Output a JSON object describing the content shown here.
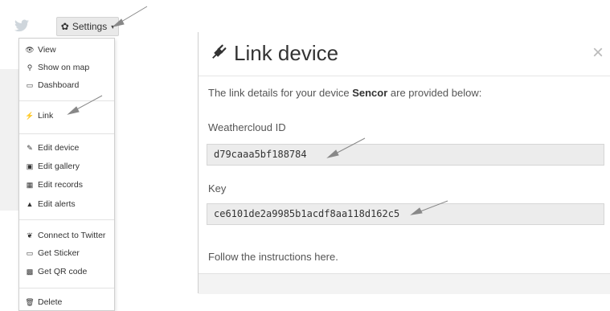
{
  "toolbar": {
    "settings_label": "Settings",
    "caret": "▾"
  },
  "menu": {
    "items": [
      {
        "icon": "eye-icon",
        "glyph": "👁",
        "label": "View"
      },
      {
        "icon": "map-marker-icon",
        "glyph": "⚲",
        "label": "Show on map"
      },
      {
        "icon": "monitor-icon",
        "glyph": "▭",
        "label": "Dashboard"
      },
      {
        "icon": "plug-icon",
        "glyph": "⚡",
        "label": "Link"
      },
      {
        "icon": "wrench-icon",
        "glyph": "✎",
        "label": "Edit device"
      },
      {
        "icon": "image-icon",
        "glyph": "▣",
        "label": "Edit gallery"
      },
      {
        "icon": "calendar-icon",
        "glyph": "▦",
        "label": "Edit records"
      },
      {
        "icon": "bell-icon",
        "glyph": "▲",
        "label": "Edit alerts"
      },
      {
        "icon": "twitter-icon",
        "glyph": "❦",
        "label": "Connect to Twitter"
      },
      {
        "icon": "sticker-icon",
        "glyph": "▭",
        "label": "Get Sticker"
      },
      {
        "icon": "qr-code-icon",
        "glyph": "▩",
        "label": "Get QR code"
      },
      {
        "icon": "trash-icon",
        "glyph": "🗑",
        "label": "Delete"
      }
    ]
  },
  "modal": {
    "title": "Link device",
    "close": "×",
    "intro_prefix": "The link details for your device ",
    "device_name": "Sencor",
    "intro_suffix": " are provided below:",
    "id_label": "Weathercloud ID",
    "id_value": "d79caaa5bf188784",
    "key_label": "Key",
    "key_value": "ce6101de2a9985b1acdf8aa118d162c5",
    "follow_text": "Follow the instructions here."
  }
}
